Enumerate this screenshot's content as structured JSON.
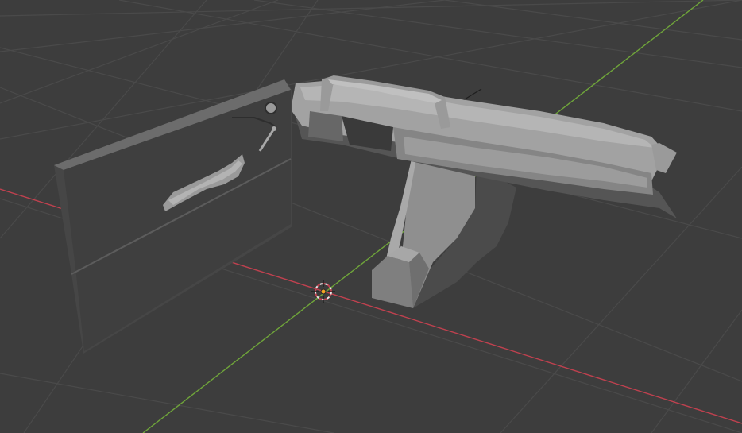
{
  "viewport": {
    "name": "3D Viewport",
    "background": "#3d3d3d",
    "grid_color": "#4a4a4a",
    "x_axis_color": "#c0414f",
    "y_axis_color": "#6fa53a",
    "shading": "solid"
  },
  "scene_objects": [
    {
      "name": "door-panel",
      "icon": "door-panel-mesh"
    },
    {
      "name": "dashboard",
      "icon": "dashboard-mesh"
    },
    {
      "name": "center-console",
      "icon": "console-mesh"
    }
  ],
  "cursor": {
    "name": "3d-cursor",
    "icon": "crosshair-ring-icon"
  },
  "origin": {
    "name": "object-origin",
    "color": "#f5a623"
  }
}
